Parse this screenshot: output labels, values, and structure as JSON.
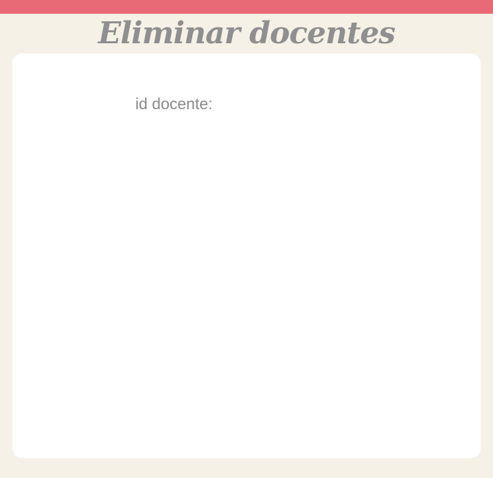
{
  "header": {
    "title": "Eliminar docentes"
  },
  "form": {
    "id_label": "id docente:"
  },
  "colors": {
    "top_bar": "#e86a76",
    "background": "#f6f1e6",
    "card": "#ffffff",
    "title_text": "#8f8f8f",
    "label_text": "#8a8a8a"
  }
}
